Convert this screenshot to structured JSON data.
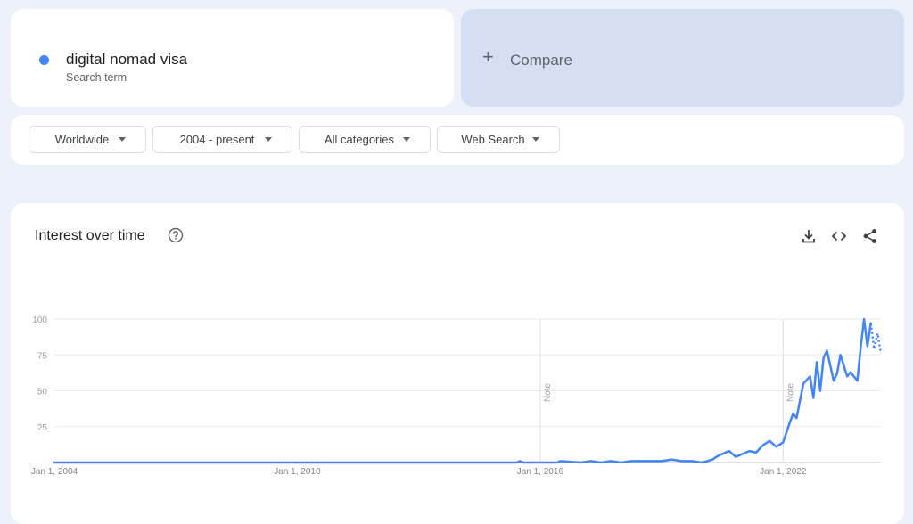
{
  "search_term": {
    "name": "digital nomad visa",
    "subtitle": "Search term",
    "color": "#4285f4"
  },
  "compare": {
    "plus": "+",
    "label": "Compare"
  },
  "filters": [
    {
      "label": "Worldwide"
    },
    {
      "label": "2004 - present"
    },
    {
      "label": "All categories"
    },
    {
      "label": "Web Search"
    }
  ],
  "chart": {
    "title": "Interest over time",
    "icons": [
      "help-icon",
      "download-icon",
      "embed-icon",
      "share-icon"
    ],
    "line_color": "#4285f4",
    "notes": [
      "Note",
      "Note"
    ]
  },
  "chart_data": {
    "type": "line",
    "title": "Interest over time",
    "xlabel": "",
    "ylabel": "",
    "ylim": [
      0,
      100
    ],
    "yticks": [
      25,
      50,
      75,
      100
    ],
    "xtick_labels": [
      "Jan 1, 2004",
      "Jan 1, 2010",
      "Jan 1, 2016",
      "Jan 1, 2022"
    ],
    "xlim": [
      "2004-01",
      "2024-06"
    ],
    "grid": true,
    "note_markers": [
      "2016-01",
      "2022-01"
    ],
    "series": [
      {
        "name": "digital nomad visa",
        "x": [
          "2004-01",
          "2015-06",
          "2015-07",
          "2015-08",
          "2016-06",
          "2016-07",
          "2017-01",
          "2017-04",
          "2017-07",
          "2017-10",
          "2018-01",
          "2018-04",
          "2018-07",
          "2018-10",
          "2019-01",
          "2019-04",
          "2019-07",
          "2019-10",
          "2020-01",
          "2020-04",
          "2020-06",
          "2020-09",
          "2020-11",
          "2021-01",
          "2021-03",
          "2021-05",
          "2021-07",
          "2021-09",
          "2021-11",
          "2022-01",
          "2022-03",
          "2022-04",
          "2022-05",
          "2022-07",
          "2022-09",
          "2022-10",
          "2022-11",
          "2022-12",
          "2023-01",
          "2023-02",
          "2023-04",
          "2023-05",
          "2023-06",
          "2023-08",
          "2023-09",
          "2023-11",
          "2023-12",
          "2024-01",
          "2024-02",
          "2024-03",
          "2024-04",
          "2024-05",
          "2024-06"
        ],
        "y": [
          0,
          0,
          1,
          0,
          0,
          1,
          0,
          1,
          0,
          1,
          0,
          1,
          1,
          1,
          1,
          2,
          1,
          1,
          0,
          2,
          5,
          8,
          4,
          6,
          8,
          7,
          12,
          15,
          11,
          14,
          28,
          34,
          31,
          55,
          60,
          45,
          70,
          50,
          73,
          78,
          57,
          62,
          75,
          60,
          63,
          57,
          80,
          100,
          81,
          97,
          79,
          90,
          76
        ],
        "dotted_from_index": 49
      }
    ]
  }
}
